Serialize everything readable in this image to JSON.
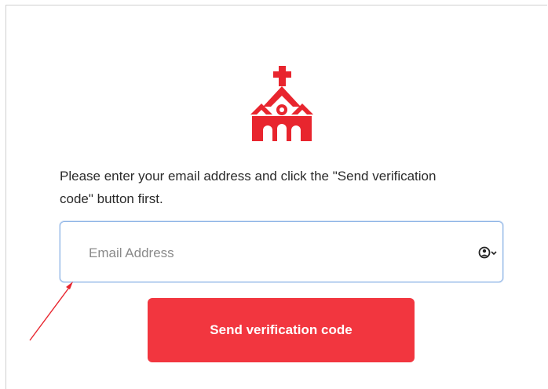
{
  "logo": {
    "icon": "church-icon",
    "color": "#e8252e"
  },
  "instructions": "Please enter your email address and click the \"Send verification code\" button first.",
  "email_field": {
    "placeholder": "Email Address",
    "value": "",
    "icon": "user-account-icon"
  },
  "send_button": {
    "label": "Send verification code",
    "color": "#f2363f"
  },
  "annotation": {
    "icon": "arrow-icon",
    "color": "#e8252e"
  }
}
